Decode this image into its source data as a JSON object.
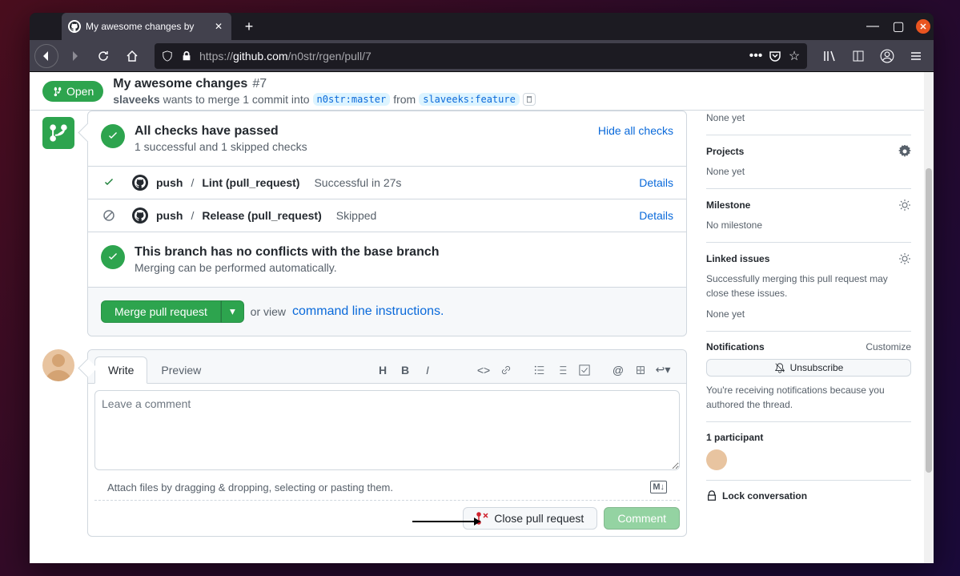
{
  "browser": {
    "tab_title": "My awesome changes by",
    "url_display_pre": "https://",
    "url_display_host": "github.com",
    "url_display_path": "/n0str/rgen/pull/7"
  },
  "pr": {
    "status": "Open",
    "title": "My awesome changes",
    "number": "#7",
    "author": "slaveeks",
    "meta_text": " wants to merge 1 commit into ",
    "base_branch": "n0str:master",
    "from_text": " from ",
    "head_branch": "slaveeks:feature"
  },
  "checks": {
    "header": "All checks have passed",
    "sub": "1 successful and 1 skipped checks",
    "hide": "Hide all checks",
    "rows": [
      {
        "prefix": "push",
        "name": "Lint (pull_request)",
        "status": "Successful in 27s",
        "icon": "pass",
        "details": "Details"
      },
      {
        "prefix": "push",
        "name": "Release (pull_request)",
        "status": "Skipped",
        "icon": "skip",
        "details": "Details"
      }
    ]
  },
  "conflicts": {
    "header": "This branch has no conflicts with the base branch",
    "sub": "Merging can be performed automatically."
  },
  "merge": {
    "button": "Merge pull request",
    "or": "or view ",
    "cli": "command line instructions"
  },
  "comment": {
    "write": "Write",
    "preview": "Preview",
    "placeholder": "Leave a comment",
    "attach": "Attach files by dragging & dropping, selecting or pasting them.",
    "close": "Close pull request",
    "submit": "Comment"
  },
  "sidebar": {
    "none_yet": "None yet",
    "projects": "Projects",
    "milestone": "Milestone",
    "no_milestone": "No milestone",
    "linked_issues": "Linked issues",
    "linked_desc": "Successfully merging this pull request may close these issues.",
    "notifications": "Notifications",
    "customize": "Customize",
    "unsubscribe": "Unsubscribe",
    "notif_desc": "You're receiving notifications because you authored the thread.",
    "participants": "1 participant",
    "lock": "Lock conversation"
  }
}
